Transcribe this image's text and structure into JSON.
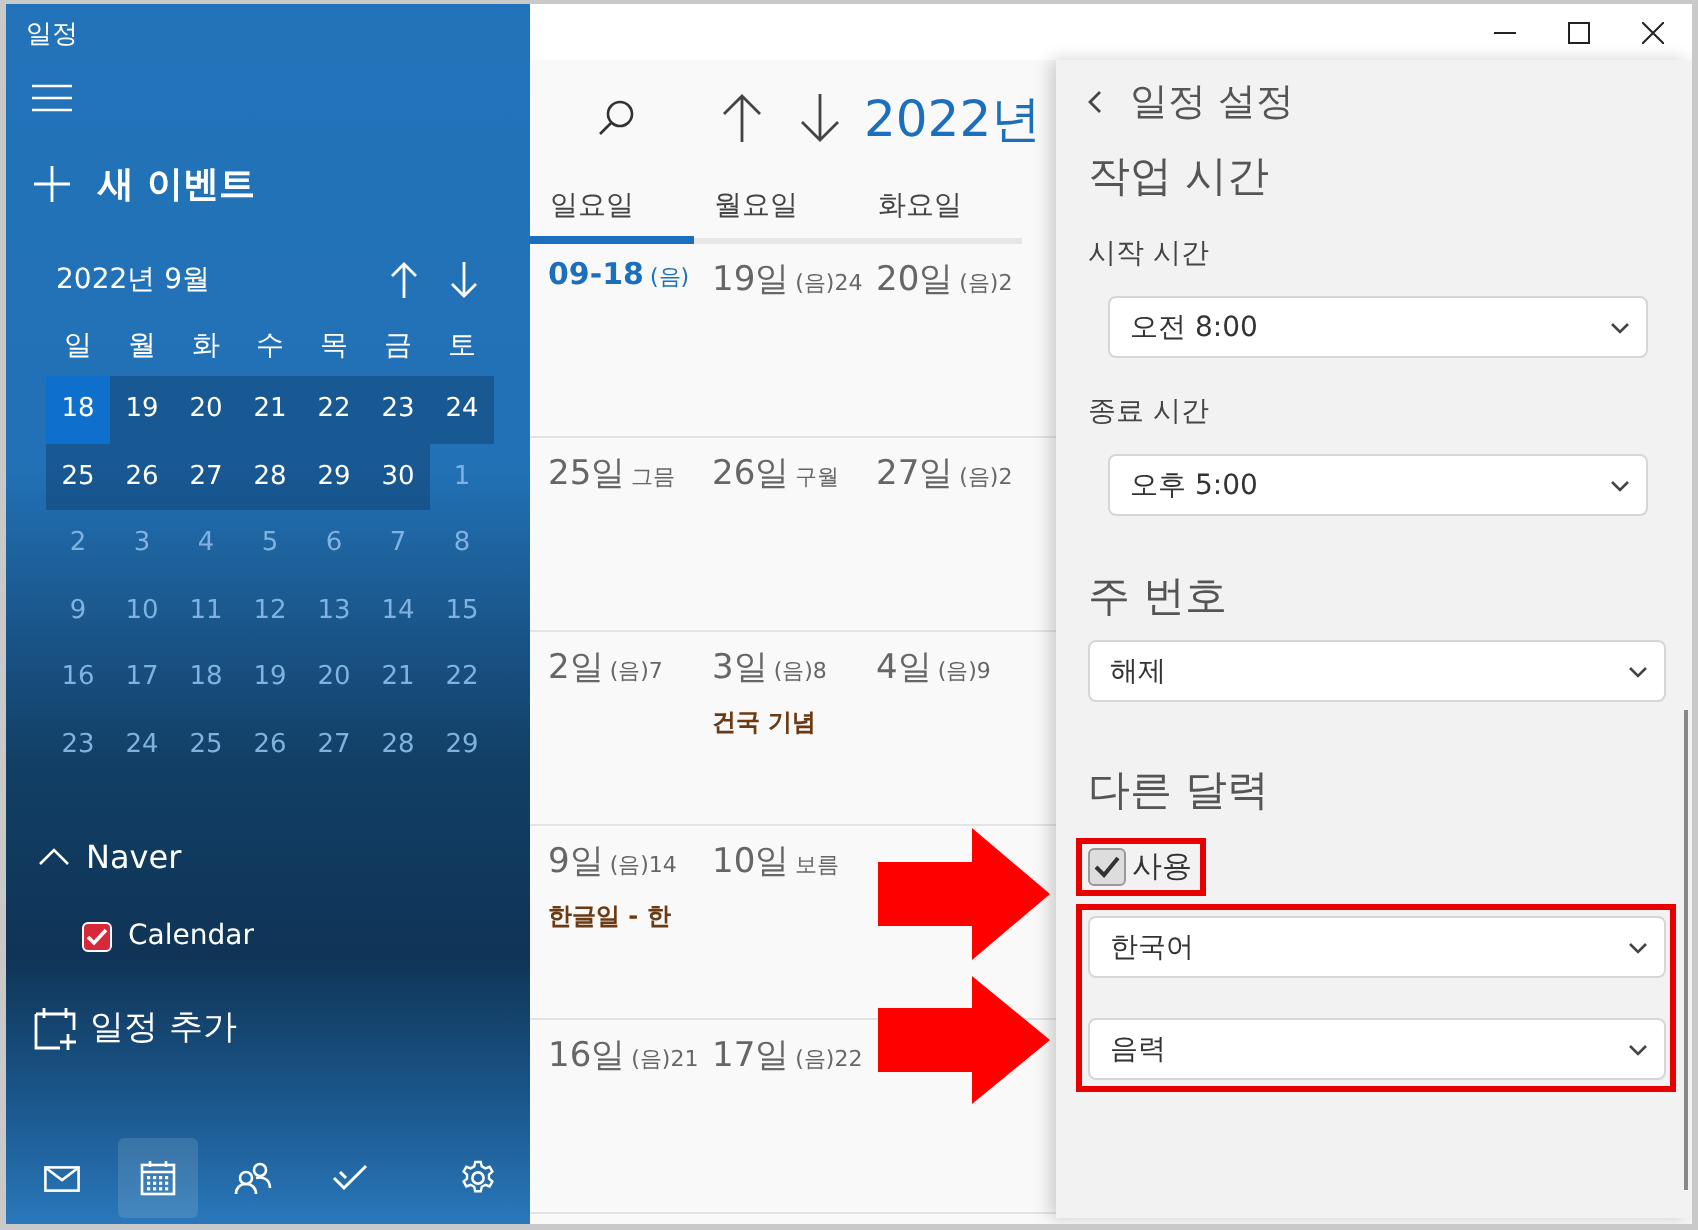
{
  "window": {
    "title": "일정"
  },
  "sidebar": {
    "new_event": "새 이벤트",
    "mini_calendar": {
      "title": "2022년 9월",
      "weekdays": [
        "일",
        "월",
        "화",
        "수",
        "목",
        "금",
        "토"
      ],
      "days": [
        {
          "label": "18",
          "kind": "current",
          "today": true
        },
        {
          "label": "19",
          "kind": "current",
          "today": false
        },
        {
          "label": "20",
          "kind": "current",
          "today": false
        },
        {
          "label": "21",
          "kind": "current",
          "today": false
        },
        {
          "label": "22",
          "kind": "current",
          "today": false
        },
        {
          "label": "23",
          "kind": "current",
          "today": false
        },
        {
          "label": "24",
          "kind": "current",
          "today": false
        },
        {
          "label": "25",
          "kind": "current",
          "today": false
        },
        {
          "label": "26",
          "kind": "current",
          "today": false
        },
        {
          "label": "27",
          "kind": "current",
          "today": false
        },
        {
          "label": "28",
          "kind": "current",
          "today": false
        },
        {
          "label": "29",
          "kind": "current",
          "today": false
        },
        {
          "label": "30",
          "kind": "current",
          "today": false
        },
        {
          "label": "1",
          "kind": "next",
          "today": false
        },
        {
          "label": "2",
          "kind": "next",
          "today": false
        },
        {
          "label": "3",
          "kind": "next",
          "today": false
        },
        {
          "label": "4",
          "kind": "next",
          "today": false
        },
        {
          "label": "5",
          "kind": "next",
          "today": false
        },
        {
          "label": "6",
          "kind": "next",
          "today": false
        },
        {
          "label": "7",
          "kind": "next",
          "today": false
        },
        {
          "label": "8",
          "kind": "next",
          "today": false
        },
        {
          "label": "9",
          "kind": "next",
          "today": false
        },
        {
          "label": "10",
          "kind": "next",
          "today": false
        },
        {
          "label": "11",
          "kind": "next",
          "today": false
        },
        {
          "label": "12",
          "kind": "next",
          "today": false
        },
        {
          "label": "13",
          "kind": "next",
          "today": false
        },
        {
          "label": "14",
          "kind": "next",
          "today": false
        },
        {
          "label": "15",
          "kind": "next",
          "today": false
        },
        {
          "label": "16",
          "kind": "next",
          "today": false
        },
        {
          "label": "17",
          "kind": "next",
          "today": false
        },
        {
          "label": "18",
          "kind": "next",
          "today": false
        },
        {
          "label": "19",
          "kind": "next",
          "today": false
        },
        {
          "label": "20",
          "kind": "next",
          "today": false
        },
        {
          "label": "21",
          "kind": "next",
          "today": false
        },
        {
          "label": "22",
          "kind": "next",
          "today": false
        },
        {
          "label": "23",
          "kind": "next",
          "today": false
        },
        {
          "label": "24",
          "kind": "next",
          "today": false
        },
        {
          "label": "25",
          "kind": "next",
          "today": false
        },
        {
          "label": "26",
          "kind": "next",
          "today": false
        },
        {
          "label": "27",
          "kind": "next",
          "today": false
        },
        {
          "label": "28",
          "kind": "next",
          "today": false
        },
        {
          "label": "29",
          "kind": "next",
          "today": false
        }
      ]
    },
    "accounts": [
      {
        "name": "Naver",
        "expanded": true,
        "calendars": [
          {
            "name": "Calendar",
            "checked": true
          }
        ]
      }
    ],
    "add_calendar": "일정 추가",
    "nav": [
      {
        "kind": "mail",
        "selected": false
      },
      {
        "kind": "calendar",
        "selected": true
      },
      {
        "kind": "people",
        "selected": false
      },
      {
        "kind": "todo",
        "selected": false
      },
      {
        "kind": "settings",
        "selected": false
      }
    ]
  },
  "calendar": {
    "month_title": "2022년",
    "weekdays": [
      {
        "label": "일요일",
        "selected": true
      },
      {
        "label": "월요일",
        "selected": false
      },
      {
        "label": "화요일",
        "selected": false
      }
    ],
    "weeks": [
      [
        {
          "day": "09-18",
          "lunar": "(음)",
          "today": true
        },
        {
          "day": "19일",
          "lunar": "(음)24",
          "today": false
        },
        {
          "day": "20일",
          "lunar": "(음)2",
          "today": false
        }
      ],
      [
        {
          "day": "25일",
          "lunar": "그믐",
          "today": false
        },
        {
          "day": "26일",
          "lunar": "구월",
          "today": false
        },
        {
          "day": "27일",
          "lunar": "(음)2",
          "today": false
        }
      ],
      [
        {
          "day": "2일",
          "lunar": "(음)7",
          "today": false
        },
        {
          "day": "3일",
          "lunar": "(음)8",
          "today": false,
          "event": "건국 기념"
        },
        {
          "day": "4일",
          "lunar": "(음)9",
          "today": false
        }
      ],
      [
        {
          "day": "9일",
          "lunar": "(음)14",
          "today": false,
          "event": "한글일 - 한"
        },
        {
          "day": "10일",
          "lunar": "보름",
          "today": false
        }
      ],
      [
        {
          "day": "16일",
          "lunar": "(음)21",
          "today": false
        },
        {
          "day": "17일",
          "lunar": "(음)22",
          "today": false
        }
      ]
    ]
  },
  "settings": {
    "title": "일정 설정",
    "work_hours": {
      "heading": "작업 시간",
      "start_label": "시작 시간",
      "start_value": "오전 8:00",
      "end_label": "종료 시간",
      "end_value": "오후 5:00"
    },
    "week_number": {
      "heading": "주 번호",
      "value": "해제"
    },
    "other_calendar": {
      "heading": "다른 달력",
      "enable": {
        "label": "사용",
        "checked": true
      },
      "language": "한국어",
      "calendar_type": "음력"
    }
  }
}
